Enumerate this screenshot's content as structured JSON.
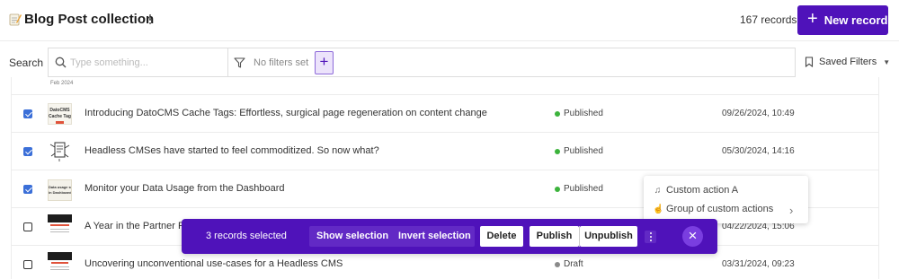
{
  "header": {
    "title": "Blog Post collection",
    "records_count": "167 records",
    "new_record_label": "New record"
  },
  "search": {
    "label": "Search",
    "placeholder": "Type something...",
    "filters_text": "No filters set",
    "saved_filters_label": "Saved Filters"
  },
  "rows": [
    {
      "checked": true,
      "title": "Introducing DatoCMS Cache Tags: Effortless, surgical page regeneration on content change",
      "status": "Published",
      "date": "09/26/2024, 10:49"
    },
    {
      "checked": true,
      "title": "Headless CMSes have started to feel commoditized. So now what?",
      "status": "Published",
      "date": "05/30/2024, 14:16"
    },
    {
      "checked": true,
      "title": "Monitor your Data Usage from the Dashboard",
      "status": "Published",
      "date": ""
    },
    {
      "checked": false,
      "title": "A Year in the Partner Pr",
      "status": "",
      "date": "04/22/2024, 15:06"
    },
    {
      "checked": false,
      "title": "Uncovering unconventional use-cases for a Headless CMS",
      "status": "Draft",
      "date": "03/31/2024, 09:23"
    }
  ],
  "partial_thumb_text": "Feb 2024",
  "thumb_texts": {
    "cache_tags": [
      "DatoCMS",
      "Cache Tags"
    ],
    "data_usage": [
      "Data usage stats",
      "in Dashboard"
    ]
  },
  "context_menu": {
    "items": [
      {
        "label": "Custom action A",
        "icon": "music-note-icon"
      },
      {
        "label": "Group of custom actions",
        "icon": "pointer-hand-icon"
      }
    ]
  },
  "selection_bar": {
    "count_text": "3 records selected",
    "show_selection": "Show selection",
    "invert_selection": "Invert selection",
    "delete": "Delete",
    "publish": "Publish",
    "unpublish": "Unpublish"
  },
  "colors": {
    "accent": "#4f12ba",
    "published": "#3cb33c",
    "draft": "#8a8a8a",
    "checkbox": "#3b6fd8"
  }
}
